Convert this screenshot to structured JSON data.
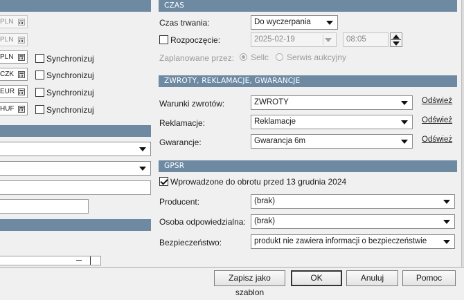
{
  "left": {
    "currencies": [
      {
        "code": "PLN",
        "disabled": true,
        "sync": false,
        "sync_label": ""
      },
      {
        "code": "PLN",
        "disabled": true,
        "sync": false,
        "sync_label": ""
      },
      {
        "code": "PLN",
        "disabled": false,
        "sync": true,
        "sync_label": "Synchronizuj"
      },
      {
        "code": "CZK",
        "disabled": false,
        "sync": true,
        "sync_label": "Synchronizuj"
      },
      {
        "code": "EUR",
        "disabled": false,
        "sync": true,
        "sync_label": "Synchronizuj"
      },
      {
        "code": "HUF",
        "disabled": false,
        "sync": true,
        "sync_label": "Synchronizuj"
      }
    ]
  },
  "czas": {
    "header": "CZAS",
    "czas_trwania_label": "Czas trwania:",
    "czas_trwania_value": "Do wyczerpania",
    "rozpoczecie_label": "Rozpoczęcie:",
    "rozpoczecie_checked": false,
    "date_value": "2025-02-19",
    "time_value": "08:05",
    "zaplanowane_label": "Zaplanowane przez:",
    "radio_sellc": "Sellc",
    "radio_serwis": "Serwis aukcyjny"
  },
  "zwroty": {
    "header": "ZWROTY, REKLAMACJE, GWARANCJE",
    "rows": [
      {
        "label": "Warunki zwrotów:",
        "value": "ZWROTY",
        "link": "Odśwież"
      },
      {
        "label": "Reklamacje:",
        "value": "Reklamacje",
        "link": "Odśwież"
      },
      {
        "label": "Gwarancje:",
        "value": "Gwarancja 6m",
        "link": "Odśwież"
      }
    ]
  },
  "gpsr": {
    "header": "GPSR",
    "checkbox_label": "Wprowadzone do obrotu przed 13 grudnia 2024",
    "checkbox_checked": true,
    "rows": [
      {
        "label": "Producent:",
        "value": "(brak)"
      },
      {
        "label": "Osoba odpowiedzialna:",
        "value": "(brak)"
      },
      {
        "label": "Bezpieczeństwo:",
        "value": "produkt nie zawiera informacji o bezpieczeństwie"
      }
    ]
  },
  "buttons": {
    "save_template": "Zapisz jako szablon",
    "ok": "OK",
    "cancel": "Anuluj",
    "help": "Pomoc"
  },
  "colors": {
    "section_header": "#6e8aa3",
    "background": "#f0f0f0"
  }
}
